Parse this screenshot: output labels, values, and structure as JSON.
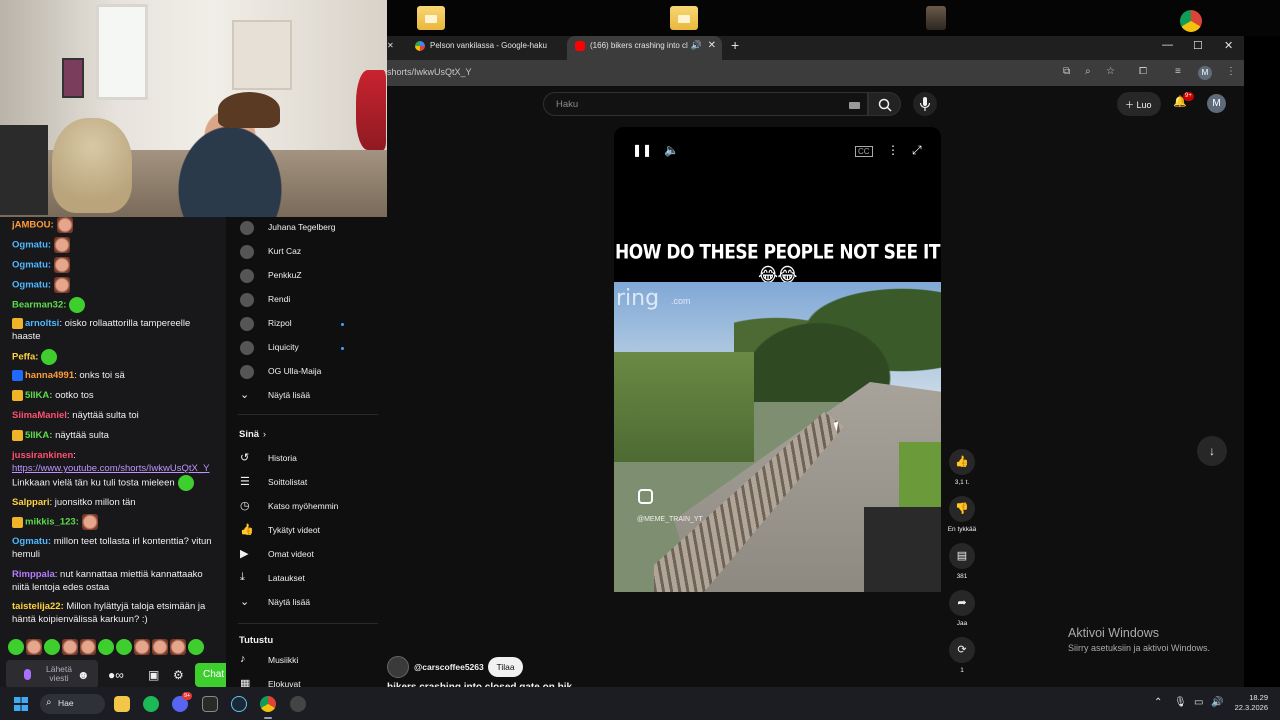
{
  "browser": {
    "tabs": [
      {
        "label": "Pelson vankilassa - Google-haku"
      },
      {
        "label": "(166) bikers crashing into cl"
      }
    ],
    "url": "shorts/IwkwUsQtX_Y",
    "profile_initial": "M"
  },
  "youtube": {
    "search_placeholder": "Haku",
    "create_label": "Luo",
    "notification_count": "9+",
    "avatar_initial": "M",
    "subscriptions": [
      {
        "name": "Juhana Tegelberg",
        "live": false
      },
      {
        "name": "Kurt Caz",
        "live": false
      },
      {
        "name": "PenkkuZ",
        "live": false
      },
      {
        "name": "Rendi",
        "live": false
      },
      {
        "name": "Rizpol",
        "live": true
      },
      {
        "name": "Liquicity",
        "live": true
      },
      {
        "name": "OG Ulla-Maija",
        "live": false
      }
    ],
    "show_more": "Näytä lisää",
    "you_heading": "Sinä",
    "you_items": [
      {
        "label": "Historia",
        "icon": "history-icon"
      },
      {
        "label": "Soittolistat",
        "icon": "playlist-icon"
      },
      {
        "label": "Katso myöhemmin",
        "icon": "clock-icon"
      },
      {
        "label": "Tykätyt videot",
        "icon": "thumbs-up-icon"
      },
      {
        "label": "Omat videot",
        "icon": "play-square-icon"
      },
      {
        "label": "Lataukset",
        "icon": "download-icon"
      }
    ],
    "show_more_2": "Näytä lisää",
    "explore_heading": "Tutustu",
    "explore_items": [
      {
        "label": "Musiikki",
        "icon": "music-icon"
      },
      {
        "label": "Elokuvat",
        "icon": "film-icon"
      }
    ],
    "short": {
      "title_overlay": "HOW DO THESE PEOPLE NOT SEE IT 😂😂",
      "watermark": "ring",
      "watermark_suffix": ".com",
      "instagram_tag": "@MEME_TRAIN_YT",
      "likes": "3,1 t.",
      "dislike_label": "En tykkää",
      "comments": "381",
      "share_label": "Jaa",
      "remix_count": "1",
      "channel": "@carscoffee5263",
      "subscribe_label": "Tilaa",
      "description": "bikers crashing into closed gate on bik"
    }
  },
  "chat": {
    "messages": [
      {
        "user": "jAMBOU:",
        "color": "#ff9c3a",
        "text": "",
        "emote": "face"
      },
      {
        "user": "Ogmatu:",
        "color": "#4fb8ff",
        "text": "",
        "emote": "face"
      },
      {
        "user": "Ogmatu:",
        "color": "#4fb8ff",
        "text": "",
        "emote": "face"
      },
      {
        "user": "Ogmatu:",
        "color": "#4fb8ff",
        "text": "",
        "emote": "face"
      },
      {
        "user": "Bearman32:",
        "color": "#5ddc4a",
        "text": "",
        "emote": "green"
      },
      {
        "user": "arnoltsi",
        "color": "#4fb8ff",
        "text": ": oisko rollaattorilla tampereelle haaste"
      },
      {
        "user": "Peffa:",
        "color": "#ffd23f",
        "text": "",
        "emote": "green"
      },
      {
        "user": "hanna4991",
        "color": "#ff9c3a",
        "text": ": onks toi sä"
      },
      {
        "user": "5IIKA:",
        "color": "#5ddc4a",
        "text": " ootko tos"
      },
      {
        "user": "SiimaManiel",
        "color": "#ff4f6d",
        "text": ": näyttää sulta toi"
      },
      {
        "user": "5IIKA:",
        "color": "#5ddc4a",
        "text": " näyttää sulta"
      },
      {
        "user": "jussirankinen",
        "color": "#ff4f6d",
        "text": ":",
        "link": "https://www.youtube.com/shorts/IwkwUsQtX_Y",
        "text2": "Linkkaan vielä tän ku tuli tosta mieleen"
      },
      {
        "user": "Salppari",
        "color": "#ffd23f",
        "text": ": juonsitko millon tän"
      },
      {
        "user": "mikkis_123:",
        "color": "#5ddc4a",
        "text": "",
        "emote": "face"
      },
      {
        "user": "Ogmatu:",
        "color": "#4fb8ff",
        "text": " millon teet tollasta irl kontenttia? vitun hemuli"
      },
      {
        "user": "Rimppala",
        "color": "#b57bff",
        "text": ": nut kannattaa miettiä kannattaako niitä lentoja edes ostaa"
      },
      {
        "user": "taistelija22:",
        "color": "#ffd23f",
        "text": " Millon hylättyjä taloja etsimään ja häntä koipienvälissä karkuun? :)"
      }
    ],
    "input_placeholder": "Lähetä viesti",
    "chat_button": "Chat"
  },
  "watermark": {
    "line1": "Aktivoi Windows",
    "line2": "Siirry asetuksiin ja aktivoi Windows."
  },
  "taskbar": {
    "search_label": "Hae",
    "discord_badge": "9+",
    "time": "18.29",
    "date": "22.3.2026"
  }
}
